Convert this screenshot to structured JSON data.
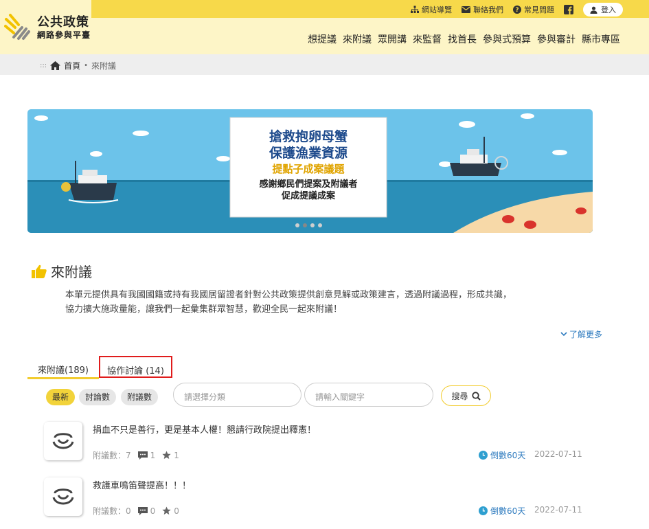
{
  "site": {
    "title": "公共政策",
    "subtitle": "網路參與平臺"
  },
  "topbar": {
    "items": [
      {
        "label": "網站導覽",
        "icon": "sitemap-icon"
      },
      {
        "label": "聯絡我們",
        "icon": "mail-icon"
      },
      {
        "label": "常見問題",
        "icon": "question-icon"
      }
    ],
    "facebook_icon": "facebook-icon",
    "login_label": "登入"
  },
  "nav": {
    "items": [
      "想提議",
      "來附議",
      "眾開講",
      "來監督",
      "找首長",
      "參與式預算",
      "參與審計",
      "縣市專區"
    ]
  },
  "breadcrumb": {
    "prefix": ":::",
    "home": "首頁",
    "separator": "•",
    "current": "來附議"
  },
  "banner": {
    "line1": "搶救抱卵母蟹",
    "line2": "保護漁業資源",
    "line3": "提點子成案議題",
    "line4": "感謝鄉民們提案及附議者",
    "line5": "促成提議成案",
    "dots_count": 4,
    "active_dot": 1
  },
  "section": {
    "title": "來附議",
    "desc_line1": "本單元提供具有我國國籍或持有我國居留證者針對公共政策提供創意見解或政策建言，透過附議過程，形成共識，",
    "desc_line2": "協力擴大施政量能，讓我們一起彙集群眾智慧，歡迎全民一起來附議！",
    "more_label": "了解更多"
  },
  "tabs": [
    {
      "label": "來附議(189)"
    },
    {
      "label": "協作討論 (14)"
    }
  ],
  "filters": {
    "chips": [
      "最新",
      "討論數",
      "附議數"
    ],
    "category_placeholder": "請選擇分類",
    "keyword_placeholder": "請輸入關鍵字",
    "search_label": "搜尋"
  },
  "items": [
    {
      "title": "捐血不只是善行，更是基本人權！懇請行政院提出釋憲！",
      "seconds": "附議數：7",
      "comments": "1",
      "stars": "1",
      "countdown": "倒數60天",
      "date": "2022-07-11"
    },
    {
      "title": "救護車鳴笛聲提高！！！",
      "seconds": "附議數：0",
      "comments": "0",
      "stars": "0",
      "countdown": "倒數60天",
      "date": "2022-07-11"
    }
  ],
  "colors": {
    "accent_yellow": "#f7d94a",
    "header_bg": "#fdf5c7",
    "highlight_red": "#e01c1c",
    "link_blue": "#2e7bbf"
  }
}
